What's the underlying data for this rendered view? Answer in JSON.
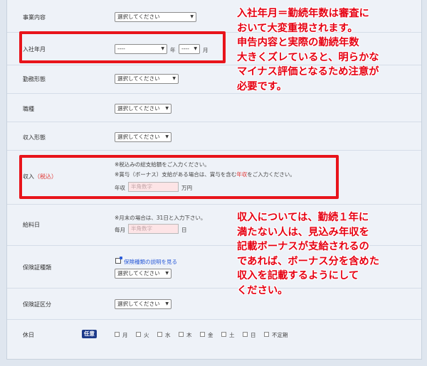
{
  "fields": {
    "business": {
      "label": "事業内容",
      "select": "選択してください"
    },
    "join_date": {
      "label": "入社年月",
      "year_select": "----",
      "year_unit": "年",
      "month_select": "----",
      "month_unit": "月"
    },
    "employment": {
      "label": "勤務形態",
      "select": "選択してください"
    },
    "job_type": {
      "label": "職種",
      "select": "選択してください"
    },
    "income_type": {
      "label": "収入形態",
      "select": "選択してください"
    },
    "income": {
      "label": "収入",
      "label_note": "（税込）",
      "note1": "※税込みの総支給額をご入力ください。",
      "note2_a": "※賞与（ボーナス）支給がある場合は、賞与を含む",
      "note2_b": "年収",
      "note2_c": "をご入力ください。",
      "prefix": "年収",
      "placeholder": "半角数字",
      "unit": "万円"
    },
    "payday": {
      "label": "給料日",
      "note": "※月末の場合は、31日と入力下さい。",
      "prefix": "毎月",
      "placeholder": "半角数字",
      "unit": "日"
    },
    "insurance_type": {
      "label": "保険証種類",
      "link": "保険種類の説明を見る",
      "select": "選択してください"
    },
    "insurance_class": {
      "label": "保険証区分",
      "select": "選択してください"
    },
    "holiday": {
      "label": "休日",
      "badge": "任意",
      "options": [
        "月",
        "火",
        "水",
        "木",
        "金",
        "土",
        "日",
        "不定期"
      ]
    }
  },
  "annotations": {
    "top": [
      "入社年月＝勤続年数は審査に",
      "おいて大変重視されます。",
      "申告内容と実際の勤続年数",
      "大きくズレていると、明らかな",
      "マイナス評価となるため注意が",
      "必要です。"
    ],
    "bottom": [
      "収入については、勤続１年に",
      "満たない人は、見込み年収を",
      "記載ボーナスが支給されるの",
      "であれば、ボーナス分を含めた",
      "収入を記載するようにして",
      "ください。"
    ]
  },
  "colors": {
    "annotation_red": "#e60012",
    "highlight_box": "#e8141b",
    "badge": "#1d3a8a",
    "input_bg": "#fde4e6"
  }
}
